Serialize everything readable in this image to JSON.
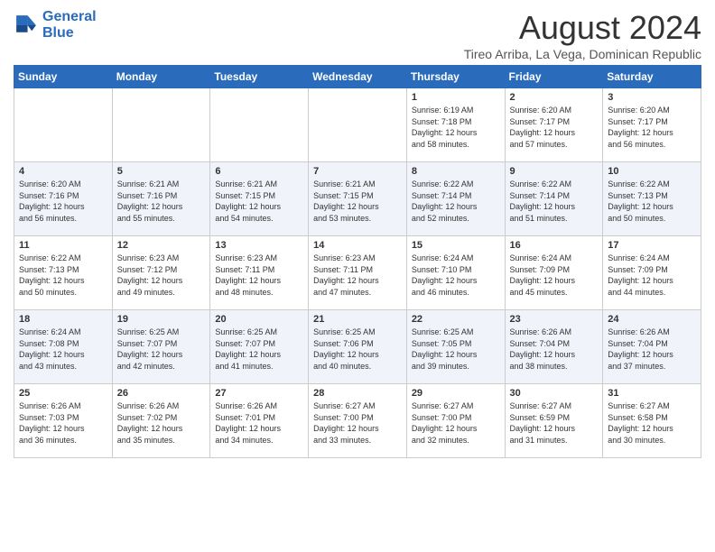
{
  "logo": {
    "line1": "General",
    "line2": "Blue"
  },
  "title": "August 2024",
  "subtitle": "Tireo Arriba, La Vega, Dominican Republic",
  "days_of_week": [
    "Sunday",
    "Monday",
    "Tuesday",
    "Wednesday",
    "Thursday",
    "Friday",
    "Saturday"
  ],
  "weeks": [
    [
      {
        "day": "",
        "info": ""
      },
      {
        "day": "",
        "info": ""
      },
      {
        "day": "",
        "info": ""
      },
      {
        "day": "",
        "info": ""
      },
      {
        "day": "1",
        "info": "Sunrise: 6:19 AM\nSunset: 7:18 PM\nDaylight: 12 hours\nand 58 minutes."
      },
      {
        "day": "2",
        "info": "Sunrise: 6:20 AM\nSunset: 7:17 PM\nDaylight: 12 hours\nand 57 minutes."
      },
      {
        "day": "3",
        "info": "Sunrise: 6:20 AM\nSunset: 7:17 PM\nDaylight: 12 hours\nand 56 minutes."
      }
    ],
    [
      {
        "day": "4",
        "info": "Sunrise: 6:20 AM\nSunset: 7:16 PM\nDaylight: 12 hours\nand 56 minutes."
      },
      {
        "day": "5",
        "info": "Sunrise: 6:21 AM\nSunset: 7:16 PM\nDaylight: 12 hours\nand 55 minutes."
      },
      {
        "day": "6",
        "info": "Sunrise: 6:21 AM\nSunset: 7:15 PM\nDaylight: 12 hours\nand 54 minutes."
      },
      {
        "day": "7",
        "info": "Sunrise: 6:21 AM\nSunset: 7:15 PM\nDaylight: 12 hours\nand 53 minutes."
      },
      {
        "day": "8",
        "info": "Sunrise: 6:22 AM\nSunset: 7:14 PM\nDaylight: 12 hours\nand 52 minutes."
      },
      {
        "day": "9",
        "info": "Sunrise: 6:22 AM\nSunset: 7:14 PM\nDaylight: 12 hours\nand 51 minutes."
      },
      {
        "day": "10",
        "info": "Sunrise: 6:22 AM\nSunset: 7:13 PM\nDaylight: 12 hours\nand 50 minutes."
      }
    ],
    [
      {
        "day": "11",
        "info": "Sunrise: 6:22 AM\nSunset: 7:13 PM\nDaylight: 12 hours\nand 50 minutes."
      },
      {
        "day": "12",
        "info": "Sunrise: 6:23 AM\nSunset: 7:12 PM\nDaylight: 12 hours\nand 49 minutes."
      },
      {
        "day": "13",
        "info": "Sunrise: 6:23 AM\nSunset: 7:11 PM\nDaylight: 12 hours\nand 48 minutes."
      },
      {
        "day": "14",
        "info": "Sunrise: 6:23 AM\nSunset: 7:11 PM\nDaylight: 12 hours\nand 47 minutes."
      },
      {
        "day": "15",
        "info": "Sunrise: 6:24 AM\nSunset: 7:10 PM\nDaylight: 12 hours\nand 46 minutes."
      },
      {
        "day": "16",
        "info": "Sunrise: 6:24 AM\nSunset: 7:09 PM\nDaylight: 12 hours\nand 45 minutes."
      },
      {
        "day": "17",
        "info": "Sunrise: 6:24 AM\nSunset: 7:09 PM\nDaylight: 12 hours\nand 44 minutes."
      }
    ],
    [
      {
        "day": "18",
        "info": "Sunrise: 6:24 AM\nSunset: 7:08 PM\nDaylight: 12 hours\nand 43 minutes."
      },
      {
        "day": "19",
        "info": "Sunrise: 6:25 AM\nSunset: 7:07 PM\nDaylight: 12 hours\nand 42 minutes."
      },
      {
        "day": "20",
        "info": "Sunrise: 6:25 AM\nSunset: 7:07 PM\nDaylight: 12 hours\nand 41 minutes."
      },
      {
        "day": "21",
        "info": "Sunrise: 6:25 AM\nSunset: 7:06 PM\nDaylight: 12 hours\nand 40 minutes."
      },
      {
        "day": "22",
        "info": "Sunrise: 6:25 AM\nSunset: 7:05 PM\nDaylight: 12 hours\nand 39 minutes."
      },
      {
        "day": "23",
        "info": "Sunrise: 6:26 AM\nSunset: 7:04 PM\nDaylight: 12 hours\nand 38 minutes."
      },
      {
        "day": "24",
        "info": "Sunrise: 6:26 AM\nSunset: 7:04 PM\nDaylight: 12 hours\nand 37 minutes."
      }
    ],
    [
      {
        "day": "25",
        "info": "Sunrise: 6:26 AM\nSunset: 7:03 PM\nDaylight: 12 hours\nand 36 minutes."
      },
      {
        "day": "26",
        "info": "Sunrise: 6:26 AM\nSunset: 7:02 PM\nDaylight: 12 hours\nand 35 minutes."
      },
      {
        "day": "27",
        "info": "Sunrise: 6:26 AM\nSunset: 7:01 PM\nDaylight: 12 hours\nand 34 minutes."
      },
      {
        "day": "28",
        "info": "Sunrise: 6:27 AM\nSunset: 7:00 PM\nDaylight: 12 hours\nand 33 minutes."
      },
      {
        "day": "29",
        "info": "Sunrise: 6:27 AM\nSunset: 7:00 PM\nDaylight: 12 hours\nand 32 minutes."
      },
      {
        "day": "30",
        "info": "Sunrise: 6:27 AM\nSunset: 6:59 PM\nDaylight: 12 hours\nand 31 minutes."
      },
      {
        "day": "31",
        "info": "Sunrise: 6:27 AM\nSunset: 6:58 PM\nDaylight: 12 hours\nand 30 minutes."
      }
    ]
  ]
}
